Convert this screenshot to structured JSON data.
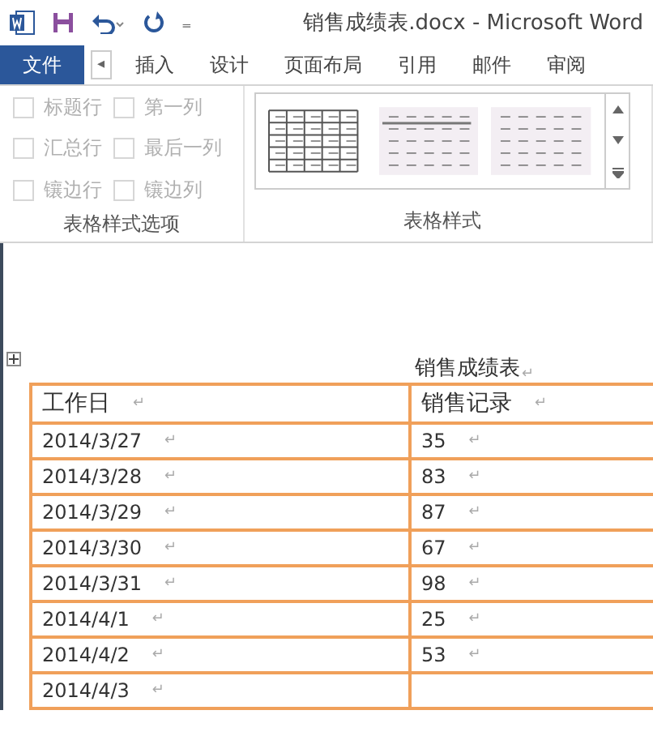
{
  "window": {
    "title": "销售成绩表.docx - Microsoft Word",
    "quick_access": {
      "customize": "₌"
    }
  },
  "tabs": [
    {
      "label": "文件",
      "kind": "file"
    },
    {
      "label": "◂",
      "kind": "scroll"
    },
    {
      "label": "插入",
      "kind": "tab"
    },
    {
      "label": "设计",
      "kind": "tab"
    },
    {
      "label": "页面布局",
      "kind": "tab"
    },
    {
      "label": "引用",
      "kind": "tab"
    },
    {
      "label": "邮件",
      "kind": "tab"
    },
    {
      "label": "审阅",
      "kind": "tab"
    }
  ],
  "ribbon": {
    "options_group": {
      "label": "表格样式选项",
      "checkboxes": [
        {
          "label": "标题行",
          "checked": false,
          "disabled": true
        },
        {
          "label": "第一列",
          "checked": false,
          "disabled": true
        },
        {
          "label": "汇总行",
          "checked": false,
          "disabled": true
        },
        {
          "label": "最后一列",
          "checked": false,
          "disabled": true
        },
        {
          "label": "镶边行",
          "checked": false,
          "disabled": true
        },
        {
          "label": "镶边列",
          "checked": false,
          "disabled": true
        }
      ]
    },
    "styles_group": {
      "label": "表格样式",
      "styles": [
        {
          "kind": "grid"
        },
        {
          "kind": "header"
        },
        {
          "kind": "light"
        }
      ]
    }
  },
  "document": {
    "title": "销售成绩表",
    "title_mark": "↵",
    "table": {
      "columns": [
        {
          "text": "工作日",
          "mark": "↵"
        },
        {
          "text": "销售记录",
          "mark": "↵"
        }
      ],
      "rows": [
        [
          {
            "text": "2014/3/27",
            "mark": "↵"
          },
          {
            "text": "35",
            "mark": "↵"
          }
        ],
        [
          {
            "text": "2014/3/28",
            "mark": "↵"
          },
          {
            "text": "83",
            "mark": "↵"
          }
        ],
        [
          {
            "text": "2014/3/29",
            "mark": "↵"
          },
          {
            "text": "87",
            "mark": "↵"
          }
        ],
        [
          {
            "text": "2014/3/30",
            "mark": "↵"
          },
          {
            "text": "67",
            "mark": "↵"
          }
        ],
        [
          {
            "text": "2014/3/31",
            "mark": "↵"
          },
          {
            "text": "98",
            "mark": "↵"
          }
        ],
        [
          {
            "text": "2014/4/1",
            "mark": "↵"
          },
          {
            "text": "25",
            "mark": "↵"
          }
        ],
        [
          {
            "text": "2014/4/2",
            "mark": "↵"
          },
          {
            "text": "53",
            "mark": "↵"
          }
        ],
        [
          {
            "text": "2014/4/3",
            "mark": "↵"
          }
        ]
      ]
    }
  }
}
